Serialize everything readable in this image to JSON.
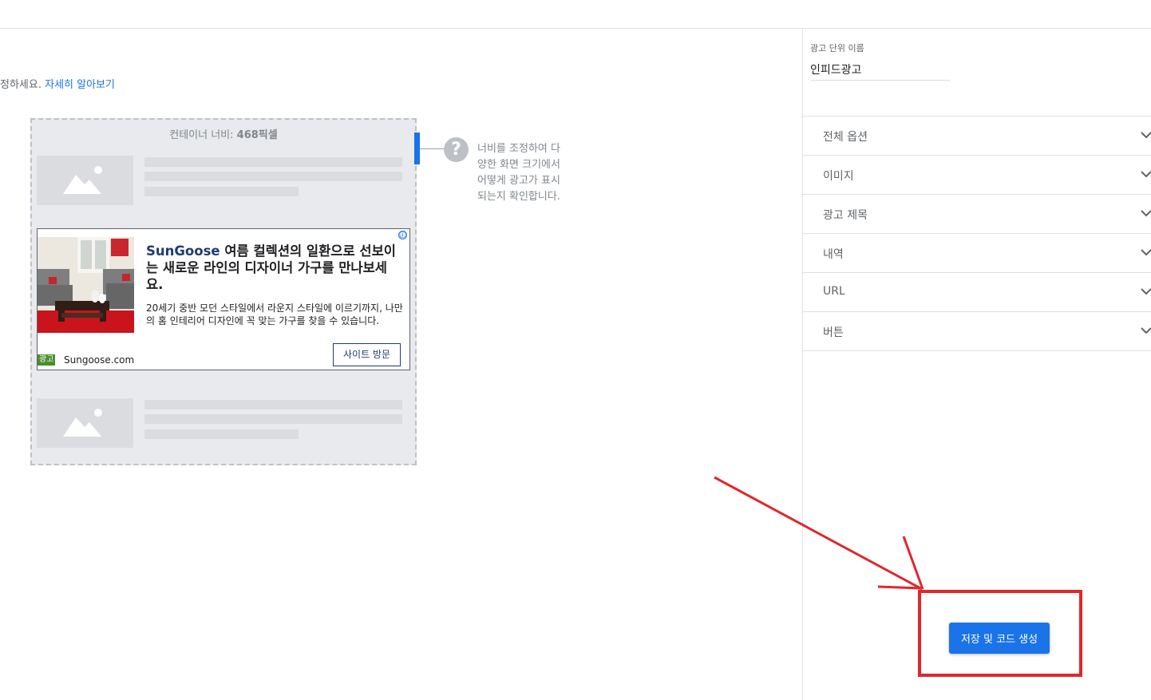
{
  "header": {},
  "intro": {
    "text_fragment": "정하세요.",
    "learn_more_link": "자세히 알아보기"
  },
  "preview": {
    "container_width_label": "컨테이너 너비:",
    "container_width_value": "468픽셀",
    "help_text": "너비를 조정하여 다양한 화면 크기에서 어떻게 광고가 표시되는지 확인합니다.",
    "help_icon": "question-mark-icon"
  },
  "ad": {
    "title_brand": "SunGoose",
    "title_rest": " 여름 컬렉션의 일환으로 선보이는 새로운 라인의 디자이너 가구를 만나보세요.",
    "description": "20세기 중반 모던 스타일에서 라운지 스타일에 이르기까지, 나만의 홈 인테리어 디자인에 꼭 맞는 가구를 찾을 수 있습니다.",
    "badge": "광고",
    "domain": "Sungoose.com",
    "cta": "사이트 방문",
    "info_icon": "ⓘ",
    "badge_color": "#4a8f2f"
  },
  "right_panel": {
    "ad_unit_name_label": "광고 단위 이름",
    "ad_unit_name_value": "인피드광고",
    "sections": [
      {
        "label": "전체 옵션"
      },
      {
        "label": "이미지"
      },
      {
        "label": "광고 제목"
      },
      {
        "label": "내역"
      },
      {
        "label": "URL"
      },
      {
        "label": "버튼"
      }
    ]
  },
  "actions": {
    "save_button": "저장 및 코드 생성"
  },
  "colors": {
    "accent": "#1a73e8",
    "annotation": "#e3262b"
  }
}
